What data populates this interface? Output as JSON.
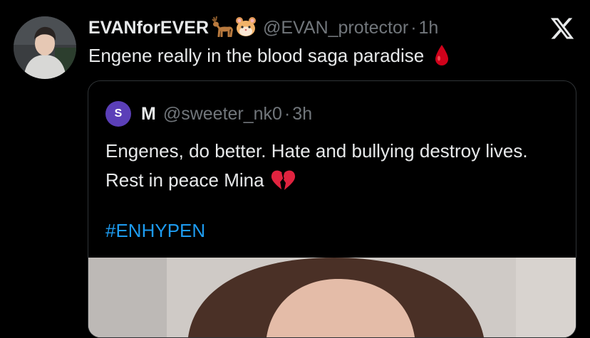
{
  "tweet": {
    "display_name": "EVANforEVER",
    "name_emojis": [
      "deer-emoji",
      "hamster-emoji"
    ],
    "handle": "@EVAN_protector",
    "separator": "·",
    "time": "1h",
    "text": "Engene really in the blood saga paradise",
    "text_emoji": "drop-of-blood-emoji"
  },
  "logo": "x-logo-icon",
  "quote": {
    "avatar_letter": "S",
    "display_name": "M",
    "handle": "@sweeter_nk0",
    "separator": "·",
    "time": "3h",
    "text": "Engenes, do better. Hate and bullying destroy lives. Rest in peace Mina",
    "text_emoji": "broken-heart-emoji",
    "hashtag": "#ENHYPEN"
  },
  "colors": {
    "background": "#000000",
    "text": "#e7e9ea",
    "secondary": "#71767b",
    "link": "#1d9bf0",
    "border": "#2f3336",
    "quote_avatar": "#5b3fb8"
  }
}
